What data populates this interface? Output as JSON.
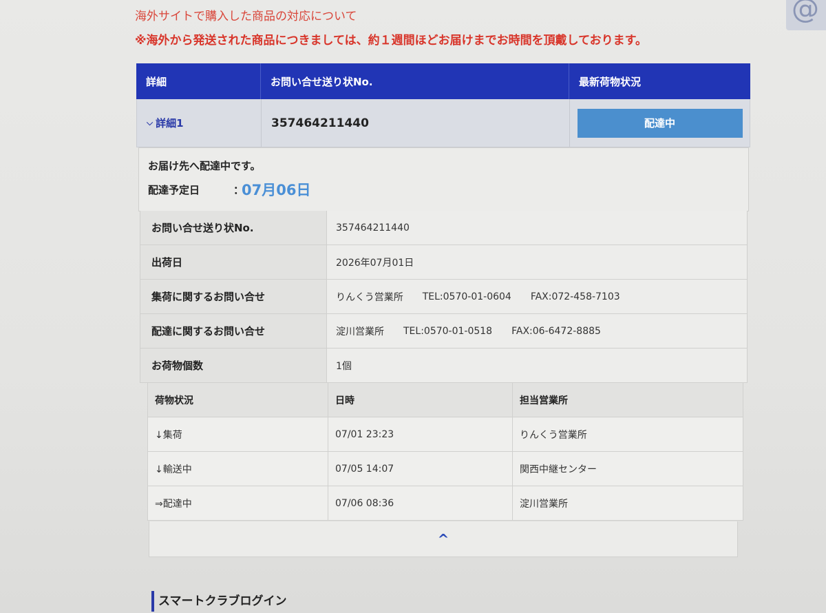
{
  "notices": {
    "link": "海外サイトで購入した商品の対応について",
    "strong": "※海外から発送された商品につきましては、約１週間ほどお届けまでお時間を頂戴しております。"
  },
  "corner_badge": "@",
  "tracking_table": {
    "headers": [
      "詳細",
      "お問い合せ送り状No.",
      "最新荷物状況"
    ],
    "row": {
      "detail_label": "詳細1",
      "tracking_no": "357464211440",
      "status": "配達中"
    }
  },
  "status_panel": {
    "message": "お届け先へ配達中です。",
    "due_label": "配達予定日",
    "due_colon": "：",
    "due_date": "07月06日"
  },
  "info_rows": [
    {
      "label": "お問い合せ送り状No.",
      "values": [
        "357464211440"
      ]
    },
    {
      "label": "出荷日",
      "values": [
        "2026年07月01日"
      ]
    },
    {
      "label": "集荷に関するお問い合せ",
      "values": [
        "りんくう営業所",
        "TEL:0570-01-0604",
        "FAX:072-458-7103"
      ]
    },
    {
      "label": "配達に関するお問い合せ",
      "values": [
        "淀川営業所",
        "TEL:0570-01-0518",
        "FAX:06-6472-8885"
      ]
    },
    {
      "label": "お荷物個数",
      "values": [
        "1個"
      ]
    }
  ],
  "history": {
    "headers": [
      "荷物状況",
      "日時",
      "担当営業所"
    ],
    "rows": [
      {
        "status": "↓集荷",
        "datetime": "07/01 23:23",
        "office": "りんくう営業所"
      },
      {
        "status": "↓輸送中",
        "datetime": "07/05 14:07",
        "office": "関西中継センター"
      },
      {
        "status": "⇒配達中",
        "datetime": "07/06 08:36",
        "office": "淀川営業所"
      }
    ]
  },
  "collapse_glyph": "^",
  "section_title": "スマートクラブログイン",
  "colors": {
    "header_blue": "#2135b5",
    "status_button": "#4b8fce",
    "notice_red": "#d8352a",
    "due_date_blue": "#4a8fd6"
  }
}
